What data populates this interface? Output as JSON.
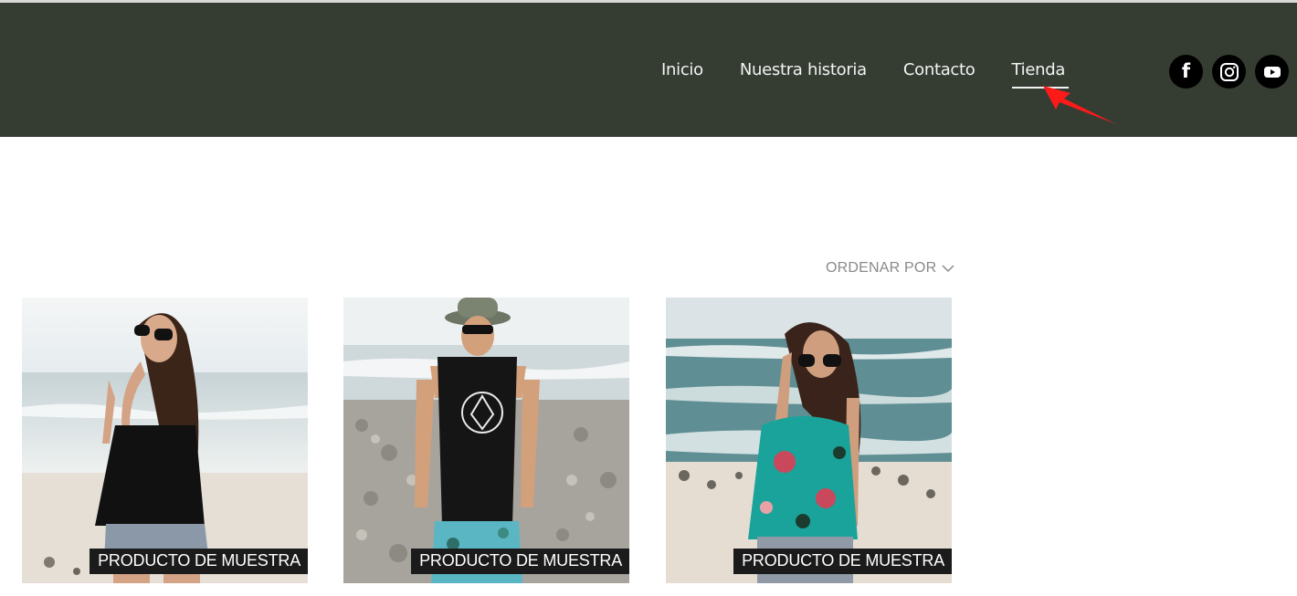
{
  "header": {
    "nav": [
      {
        "label": "Inicio",
        "active": false
      },
      {
        "label": "Nuestra historia",
        "active": false
      },
      {
        "label": "Contacto",
        "active": false
      },
      {
        "label": "Tienda",
        "active": true
      }
    ],
    "social": [
      {
        "icon": "facebook-icon",
        "glyph": "f"
      },
      {
        "icon": "instagram-icon"
      },
      {
        "icon": "youtube-icon"
      }
    ],
    "background_color": "#353d33",
    "annotation_color": "#ff1a1a"
  },
  "shop": {
    "sort_label": "ORDENAR POR",
    "products": [
      {
        "badge": "PRODUCTO DE MUESTRA",
        "image": "woman-black-top-beach"
      },
      {
        "badge": "PRODUCTO DE MUESTRA",
        "image": "man-hat-tank-top-beach"
      },
      {
        "badge": "PRODUCTO DE MUESTRA",
        "image": "woman-floral-top-beach"
      }
    ]
  }
}
